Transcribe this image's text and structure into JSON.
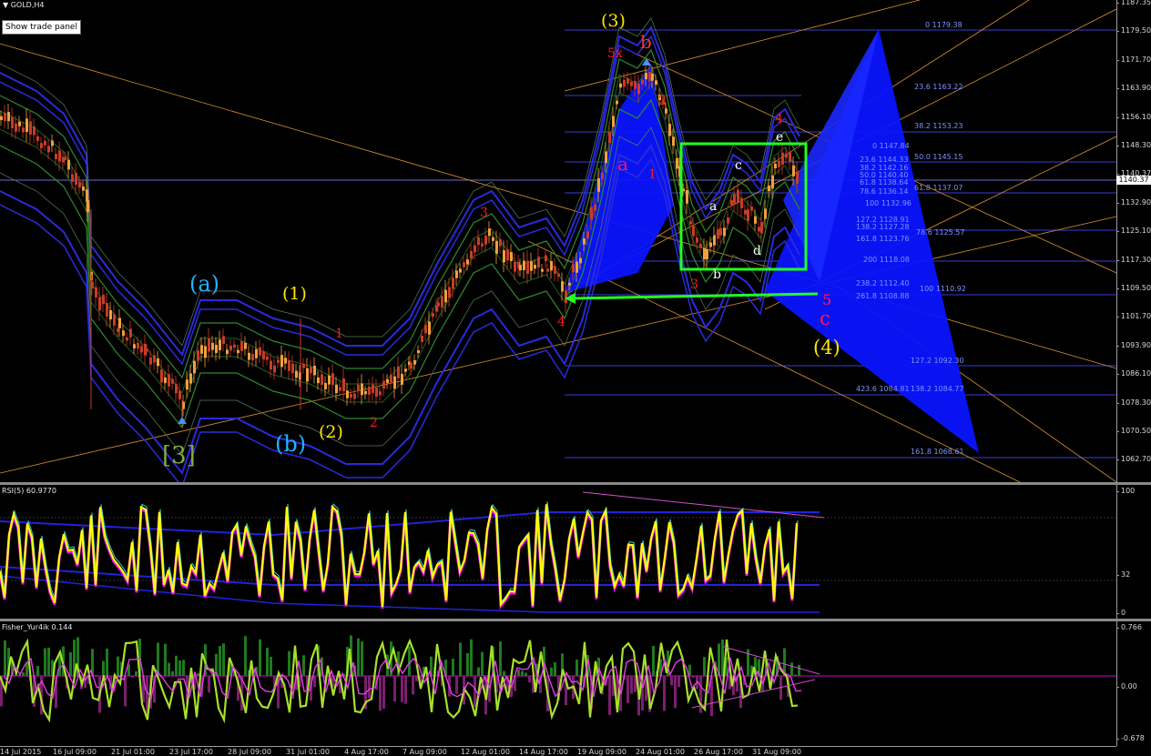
{
  "chart": {
    "title": "GOLD,H4",
    "show_trade_panel": "Show trade panel",
    "current_price": "1140.37",
    "price_ticks": [
      "1187.35",
      "1179.50",
      "1171.70",
      "1163.90",
      "1156.10",
      "1148.30",
      "1140.37",
      "1132.90",
      "1125.10",
      "1117.30",
      "1109.50",
      "1101.70",
      "1093.90",
      "1086.10",
      "1078.30",
      "1070.50",
      "1062.70"
    ],
    "fib_levels": [
      "0 1179.38",
      "23.6 1163.22",
      "38.2 1153.23",
      "0 1147.84",
      "50.0 1145.15",
      "23.6 1144.33",
      "38.2 1142.16",
      "50.0 1140.40",
      "61.8 1138.64",
      "61.8 1137.07",
      "78.6 1136.14",
      "100 1132.96",
      "127.2 1128.91",
      "138.2 1127.28",
      "161.8 1123.76",
      "78.6 1125.57",
      "200 1118.08",
      "238.2 1112.40",
      "261.8 1108.88",
      "100 1110.92",
      "127.2 1092.30",
      "423.6 1084.81",
      "138.2 1084.77",
      "161.8 1068.61"
    ],
    "wave_labels": {
      "w3_top": "(3)",
      "b_top": "b",
      "x5": "5x",
      "a_red": "a",
      "one_red": "1",
      "two_red": "2",
      "three_red_l": "3",
      "four_red_r": "4",
      "a_paren": "(a)",
      "one_paren": "(1)",
      "one_small": "1",
      "b_paren": "(b)",
      "two_paren": "(2)",
      "two_small": "2",
      "bracket3": "[3]",
      "four_left": "4",
      "e_w": "e",
      "c_w": "c",
      "a_w": "a",
      "b_w": "b",
      "d_w": "d",
      "three_red_b": "3",
      "five_red": "5",
      "c_red": "c",
      "w4_paren": "(4)"
    }
  },
  "rsi": {
    "title": "RSI(5) 60.9770",
    "ticks": [
      "100",
      "32",
      "0"
    ]
  },
  "fisher": {
    "title": "Fisher_Yur4ik 0.144",
    "ticks": [
      "0.766",
      "0.00",
      "-0.678"
    ]
  },
  "time_axis": [
    "14 Jul 2015",
    "16 Jul 09:00",
    "21 Jul 01:00",
    "23 Jul 17:00",
    "28 Jul 09:00",
    "31 Jul 01:00",
    "4 Aug 17:00",
    "7 Aug 09:00",
    "12 Aug 01:00",
    "14 Aug 17:00",
    "19 Aug 09:00",
    "24 Aug 01:00",
    "26 Aug 17:00",
    "31 Aug 09:00"
  ],
  "colors": {
    "bg": "#000000",
    "candle_up": "#f0a03c",
    "candle_down": "#c83c28",
    "triangle": "#0a14ff",
    "fib_text": "#7d94ff",
    "rsi_line": "#ffff00",
    "rsi_shadow": "#ff00ff",
    "fisher_up": "#1f7a1f",
    "fisher_down": "#7a1f6e",
    "box": "#22ff22"
  }
}
